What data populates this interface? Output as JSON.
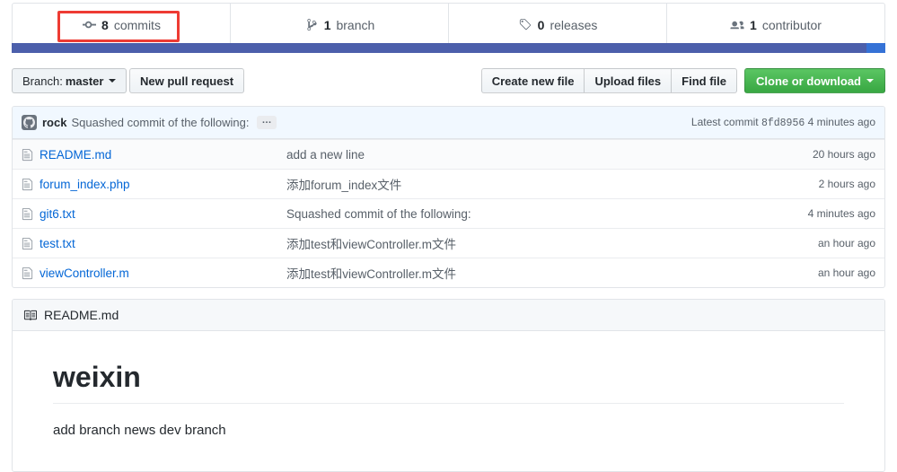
{
  "stats": [
    {
      "icon": "commit-icon",
      "count": "8",
      "label": "commits",
      "name": "commits"
    },
    {
      "icon": "branch-icon",
      "count": "1",
      "label": "branch",
      "name": "branches"
    },
    {
      "icon": "tag-icon",
      "count": "0",
      "label": "releases",
      "name": "releases"
    },
    {
      "icon": "people-icon",
      "count": "1",
      "label": "contributor",
      "name": "contributors"
    }
  ],
  "language_bar": [
    {
      "name": "primary",
      "color": "#4c5fab",
      "percent": 97.8
    },
    {
      "name": "secondary",
      "color": "#3572d6",
      "percent": 2.2
    }
  ],
  "toolbar": {
    "branch_prefix": "Branch:",
    "branch_name": "master",
    "new_pull_request": "New pull request",
    "create_new_file": "Create new file",
    "upload_files": "Upload files",
    "find_file": "Find file",
    "clone_or_download": "Clone or download"
  },
  "latest_commit": {
    "author": "rock",
    "message": "Squashed commit of the following:",
    "expand_label": "…",
    "label": "Latest commit",
    "sha": "8fd8956",
    "time": "4 minutes ago"
  },
  "files": [
    {
      "name": "README.md",
      "message": "add a new line",
      "time": "20 hours ago"
    },
    {
      "name": "forum_index.php",
      "message": "添加forum_index文件",
      "time": "2 hours ago"
    },
    {
      "name": "git6.txt",
      "message": "Squashed commit of the following:",
      "time": "4 minutes ago"
    },
    {
      "name": "test.txt",
      "message": "添加test和viewController.m文件",
      "time": "an hour ago"
    },
    {
      "name": "viewController.m",
      "message": "添加test和viewController.m文件",
      "time": "an hour ago"
    }
  ],
  "readme": {
    "title": "README.md",
    "heading": "weixin",
    "paragraph": "add branch news dev branch"
  },
  "colors": {
    "link": "#0366d6",
    "green_button": "#3baa45",
    "annotation": "#ee3b33",
    "commit_bar": "#f1f8ff"
  }
}
